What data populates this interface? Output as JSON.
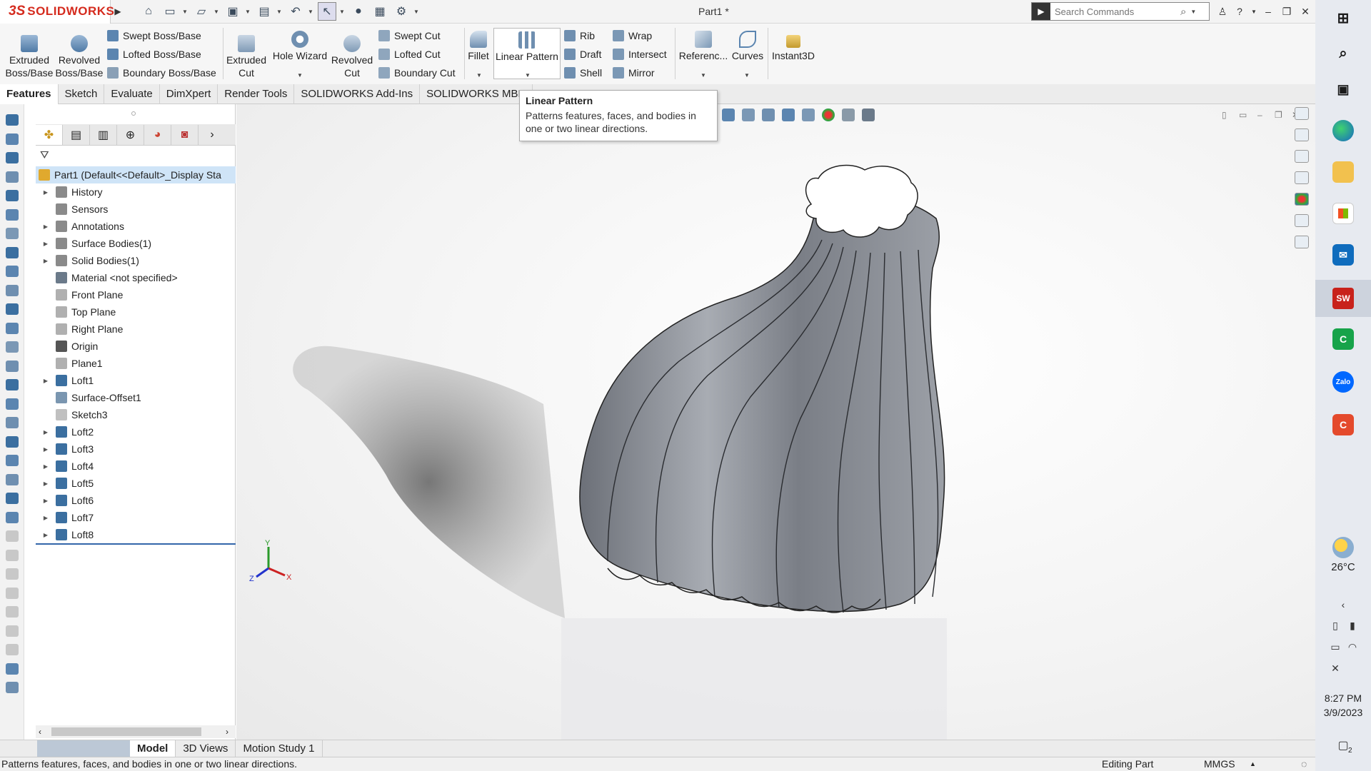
{
  "app": {
    "brand_prefix": "3S",
    "brand_name": "SOLIDWORKS",
    "document_title": "Part1 *",
    "search_placeholder": "Search Commands"
  },
  "ribbon": {
    "extruded_boss": [
      "Extruded",
      "Boss/Base"
    ],
    "revolved_boss": [
      "Revolved",
      "Boss/Base"
    ],
    "swept_boss": "Swept Boss/Base",
    "lofted_boss": "Lofted Boss/Base",
    "boundary_boss": "Boundary Boss/Base",
    "extruded_cut": [
      "Extruded",
      "Cut"
    ],
    "hole_wizard": "Hole Wizard",
    "revolved_cut": [
      "Revolved",
      "Cut"
    ],
    "swept_cut": "Swept Cut",
    "lofted_cut": "Lofted Cut",
    "boundary_cut": "Boundary Cut",
    "fillet": "Fillet",
    "linear_pattern": "Linear Pattern",
    "rib": "Rib",
    "draft": "Draft",
    "shell": "Shell",
    "wrap": "Wrap",
    "intersect": "Intersect",
    "mirror": "Mirror",
    "reference": "Referenc...",
    "curves": "Curves",
    "instant3d": "Instant3D"
  },
  "tabs": [
    "Features",
    "Sketch",
    "Evaluate",
    "DimXpert",
    "Render Tools",
    "SOLIDWORKS Add-Ins",
    "SOLIDWORKS MBD"
  ],
  "tooltip": {
    "title": "Linear Pattern",
    "body": "Patterns features, faces, and bodies in one or two linear directions."
  },
  "tree": {
    "root": "Part1  (Default<<Default>_Display Sta",
    "items": [
      {
        "label": "History",
        "expandable": true,
        "color": "#8a8a8a"
      },
      {
        "label": "Sensors",
        "expandable": false,
        "color": "#8a8a8a"
      },
      {
        "label": "Annotations",
        "expandable": true,
        "color": "#8a8a8a"
      },
      {
        "label": "Surface Bodies(1)",
        "expandable": true,
        "color": "#8a8a8a"
      },
      {
        "label": "Solid Bodies(1)",
        "expandable": true,
        "color": "#8a8a8a"
      },
      {
        "label": "Material <not specified>",
        "expandable": false,
        "color": "#6b7a8a"
      },
      {
        "label": "Front Plane",
        "expandable": false,
        "color": "#b0b0b0"
      },
      {
        "label": "Top Plane",
        "expandable": false,
        "color": "#b0b0b0"
      },
      {
        "label": "Right Plane",
        "expandable": false,
        "color": "#b0b0b0"
      },
      {
        "label": "Origin",
        "expandable": false,
        "color": "#555555"
      },
      {
        "label": "Plane1",
        "expandable": false,
        "color": "#b0b0b0"
      },
      {
        "label": "Loft1",
        "expandable": true,
        "color": "#3b6fa0"
      },
      {
        "label": "Surface-Offset1",
        "expandable": false,
        "color": "#7a96b0"
      },
      {
        "label": "Sketch3",
        "expandable": false,
        "color": "#c0c0c0"
      },
      {
        "label": "Loft2",
        "expandable": true,
        "color": "#3b6fa0"
      },
      {
        "label": "Loft3",
        "expandable": true,
        "color": "#3b6fa0"
      },
      {
        "label": "Loft4",
        "expandable": true,
        "color": "#3b6fa0"
      },
      {
        "label": "Loft5",
        "expandable": true,
        "color": "#3b6fa0"
      },
      {
        "label": "Loft6",
        "expandable": true,
        "color": "#3b6fa0"
      },
      {
        "label": "Loft7",
        "expandable": true,
        "color": "#3b6fa0"
      },
      {
        "label": "Loft8",
        "expandable": true,
        "color": "#3b6fa0"
      }
    ]
  },
  "triad": {
    "x": "X",
    "y": "Y",
    "z": "Z"
  },
  "bottom_tabs": [
    "Model",
    "3D Views",
    "Motion Study 1"
  ],
  "status": {
    "text": "Patterns features, faces, and bodies in one or two linear directions.",
    "mode": "Editing Part",
    "units": "MMGS"
  },
  "taskbar": {
    "weather": "26°C",
    "time": "8:27 PM",
    "date": "3/9/2023",
    "notifications": "2",
    "sw_badge": "SW",
    "zalo": "Zalo"
  },
  "colors": {
    "brand": "#d52b1e",
    "selection": "#cfe4f7",
    "model_gray": "#8e9299"
  }
}
